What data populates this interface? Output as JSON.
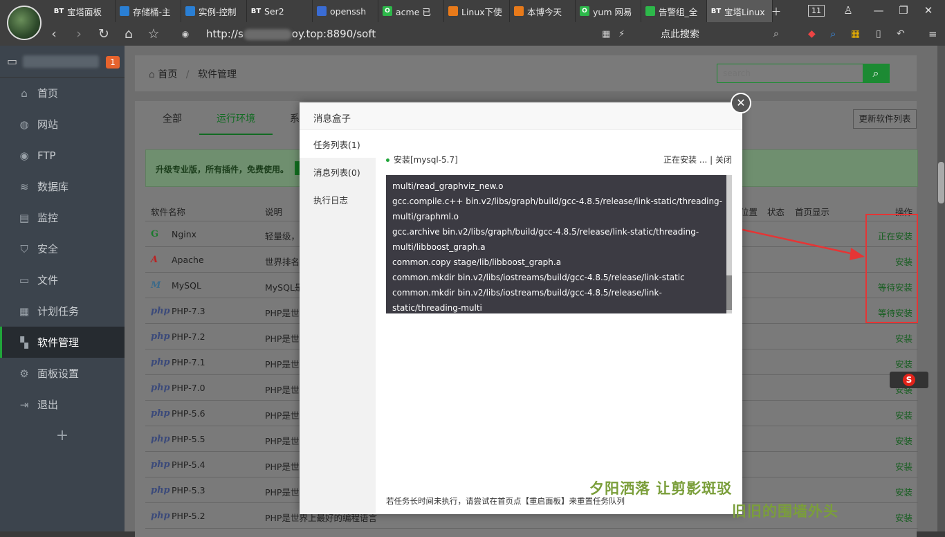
{
  "browser": {
    "tabs": [
      {
        "icon": "BT",
        "title": "宝塔面板",
        "color": "#555"
      },
      {
        "icon": "cloud",
        "title": "存储桶-主",
        "color": "#2a7fd4"
      },
      {
        "icon": "cloud",
        "title": "实例-控制",
        "color": "#2a7fd4"
      },
      {
        "icon": "BT",
        "title": "Ser2",
        "color": "#555"
      },
      {
        "icon": "pen",
        "title": "openssh",
        "color": "#3a6cd4"
      },
      {
        "icon": "O",
        "title": "acme 已",
        "color": "#2db84a"
      },
      {
        "icon": "rss",
        "title": "Linux下使",
        "color": "#e87a1a"
      },
      {
        "icon": "rss",
        "title": "本博今天",
        "color": "#e87a1a"
      },
      {
        "icon": "O",
        "title": "yum 网易",
        "color": "#2db84a"
      },
      {
        "icon": "leaf",
        "title": "告警组_全",
        "color": "#2db84a"
      },
      {
        "icon": "BT",
        "title": "宝塔Linux",
        "color": "#555"
      }
    ],
    "tab_count": "11",
    "url_prefix": "http://s",
    "url_suffix": "oy.top:8890/soft",
    "search_label": "点此搜索"
  },
  "sidebar": {
    "badge": "1",
    "items": [
      {
        "label": "首页",
        "icon": "⌂"
      },
      {
        "label": "网站",
        "icon": "◍"
      },
      {
        "label": "FTP",
        "icon": "◉"
      },
      {
        "label": "数据库",
        "icon": "≋"
      },
      {
        "label": "监控",
        "icon": "▤"
      },
      {
        "label": "安全",
        "icon": "⛉"
      },
      {
        "label": "文件",
        "icon": "▭"
      },
      {
        "label": "计划任务",
        "icon": "▦"
      },
      {
        "label": "软件管理",
        "icon": "▚"
      },
      {
        "label": "面板设置",
        "icon": "⚙"
      },
      {
        "label": "退出",
        "icon": "⇥"
      }
    ],
    "add": "+"
  },
  "breadcrumb": {
    "home": "首页",
    "sep": "/",
    "current": "软件管理"
  },
  "search": {
    "placeholder": "search"
  },
  "soft": {
    "tabs": [
      "全部",
      "运行环境",
      "系"
    ],
    "refresh": "更新软件列表",
    "promo": "升级专业版，所有插件，免费使用。",
    "headers": {
      "name": "软件名称",
      "desc": "说明",
      "loc": "位置",
      "status": "状态",
      "home": "首页显示",
      "op": "操作"
    },
    "rows": [
      {
        "icon": "G",
        "name": "Nginx",
        "desc": "轻量级，",
        "op": "正在安装"
      },
      {
        "icon": "A",
        "name": "Apache",
        "desc": "世界排名第",
        "op": "安装"
      },
      {
        "icon": "M",
        "name": "MySQL",
        "desc": "MySQL是",
        "op": "等待安装"
      },
      {
        "icon": "php",
        "name": "PHP-7.3",
        "desc": "PHP是世",
        "op": "等待安装"
      },
      {
        "icon": "php",
        "name": "PHP-7.2",
        "desc": "PHP是世",
        "op": "安装"
      },
      {
        "icon": "php",
        "name": "PHP-7.1",
        "desc": "PHP是世",
        "op": "安装"
      },
      {
        "icon": "php",
        "name": "PHP-7.0",
        "desc": "PHP是世",
        "op": "安装"
      },
      {
        "icon": "php",
        "name": "PHP-5.6",
        "desc": "PHP是世",
        "op": "安装"
      },
      {
        "icon": "php",
        "name": "PHP-5.5",
        "desc": "PHP是世",
        "op": "安装"
      },
      {
        "icon": "php",
        "name": "PHP-5.4",
        "desc": "PHP是世",
        "op": "安装"
      },
      {
        "icon": "php",
        "name": "PHP-5.3",
        "desc": "PHP是世",
        "op": "安装"
      },
      {
        "icon": "php",
        "name": "PHP-5.2",
        "desc": "PHP是世界上最好的编程语言",
        "op": "安装"
      }
    ]
  },
  "modal": {
    "title": "消息盒子",
    "nav": [
      "任务列表(1)",
      "消息列表(0)",
      "执行日志"
    ],
    "task_name": "安装[mysql-5.7]",
    "task_status": "正在安装 ...",
    "task_close": "| 关闭",
    "log_lines": [
      "multi/read_graphviz_new.o",
      "gcc.compile.c++ bin.v2/libs/graph/build/gcc-4.8.5/release/link-static/threading-",
      "multi/graphml.o",
      "gcc.archive bin.v2/libs/graph/build/gcc-4.8.5/release/link-static/threading-",
      "multi/libboost_graph.a",
      "common.copy stage/lib/libboost_graph.a",
      "common.mkdir bin.v2/libs/iostreams/build/gcc-4.8.5/release/link-static",
      "common.mkdir bin.v2/libs/iostreams/build/gcc-4.8.5/release/link-static/threading-multi"
    ],
    "footer": "若任务长时间未执行，请尝试在首页点【重启面板】来重置任务队列"
  },
  "watermark": {
    "line1": "夕阳洒落 让剪影斑驳",
    "line2": "旧旧的围墙外头"
  },
  "accent": "#20a53a"
}
